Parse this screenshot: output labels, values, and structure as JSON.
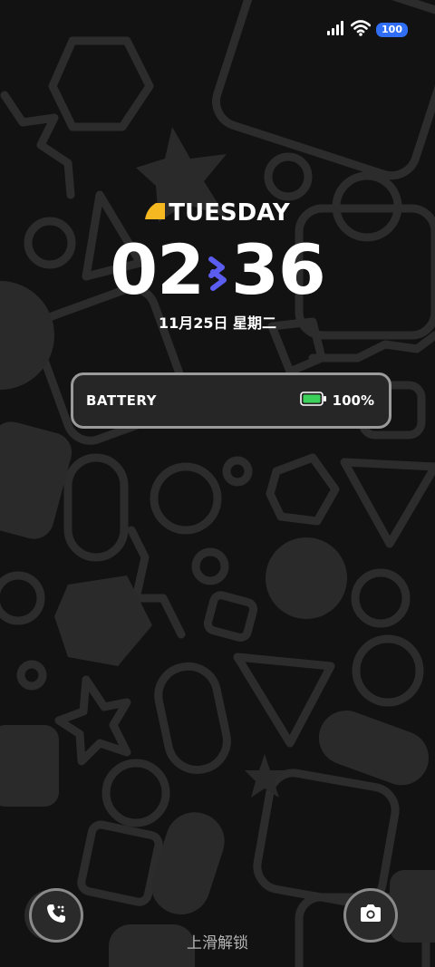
{
  "status_bar": {
    "battery_level": "100"
  },
  "clock": {
    "day": "TUESDAY",
    "hours": "02",
    "minutes": "36",
    "date": "11月25日  星期二"
  },
  "battery_widget": {
    "label": "BATTERY",
    "percent_text": "100%",
    "level": 1.0
  },
  "bottom": {
    "swipe_hint": "上滑解锁"
  },
  "colors": {
    "accent_yellow": "#f5b820",
    "accent_purple": "#5b5cf0",
    "battery_green": "#3bd15a",
    "status_battery_blue": "#2f6ef5",
    "wallpaper_shape": "#2b2b2b",
    "wallpaper_fill": "#343434"
  },
  "icons": {
    "signal": "cellular-signal-icon",
    "wifi": "wifi-icon",
    "phone": "phone-icon",
    "camera": "camera-icon",
    "battery": "battery-icon"
  }
}
